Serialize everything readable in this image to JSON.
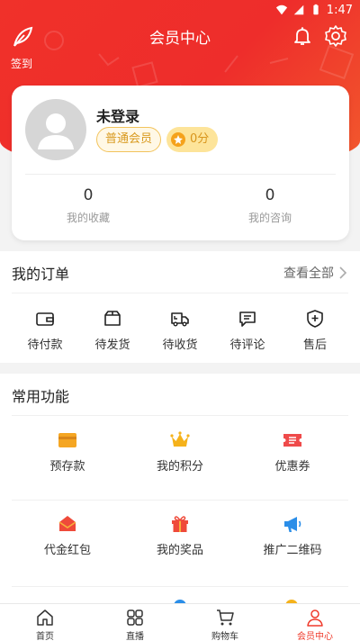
{
  "status_bar": {
    "time": "1:47"
  },
  "header": {
    "title": "会员中心",
    "signin_label": "签到",
    "bg_color": "#ef302b"
  },
  "profile": {
    "username": "未登录",
    "member_level": "普通会员",
    "points": "0分",
    "stats": [
      {
        "value": "0",
        "label": "我的收藏"
      },
      {
        "value": "0",
        "label": "我的咨询"
      }
    ]
  },
  "orders": {
    "title": "我的订单",
    "see_all": "查看全部",
    "items": [
      {
        "label": "待付款",
        "icon": "wallet-icon"
      },
      {
        "label": "待发货",
        "icon": "box-icon"
      },
      {
        "label": "待收货",
        "icon": "truck-icon"
      },
      {
        "label": "待评论",
        "icon": "comment-icon"
      },
      {
        "label": "售后",
        "icon": "shield-plus-icon"
      }
    ]
  },
  "functions": {
    "title": "常用功能",
    "items": [
      {
        "label": "预存款",
        "icon": "card-icon",
        "color": "#f5a623"
      },
      {
        "label": "我的积分",
        "icon": "crown-icon",
        "color": "#f5b21b"
      },
      {
        "label": "优惠券",
        "icon": "coupon-icon",
        "color": "#ef4a4a"
      },
      {
        "label": "代金红包",
        "icon": "envelope-icon",
        "color": "#ef4a3a"
      },
      {
        "label": "我的奖品",
        "icon": "gift-icon",
        "color": "#ef4a3a"
      },
      {
        "label": "推广二维码",
        "icon": "megaphone-icon",
        "color": "#2b8ee8"
      }
    ]
  },
  "bottom_nav": {
    "active_color": "#ef3a2b",
    "items": [
      {
        "label": "首页",
        "icon": "home-icon"
      },
      {
        "label": "直播",
        "icon": "grid-icon"
      },
      {
        "label": "购物车",
        "icon": "cart-icon"
      },
      {
        "label": "会员中心",
        "icon": "user-icon"
      }
    ]
  }
}
